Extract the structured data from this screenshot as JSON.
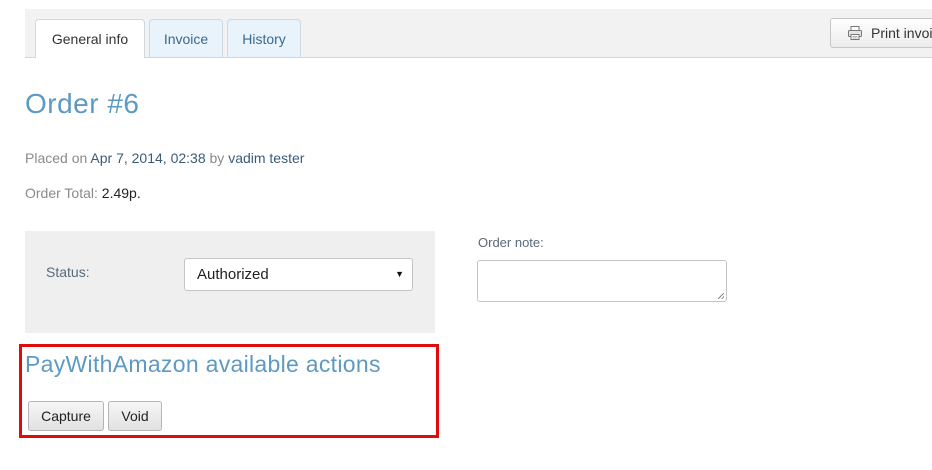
{
  "tabs": [
    {
      "label": "General info",
      "active": true
    },
    {
      "label": "Invoice",
      "active": false
    },
    {
      "label": "History",
      "active": false
    }
  ],
  "toolbar": {
    "print_label": "Print invoi",
    "print_icon": "printer-icon"
  },
  "order": {
    "title": "Order #6",
    "placed_prefix": "Placed on",
    "placed_date": "Apr 7, 2014, 02:38",
    "placed_by_word": "by",
    "placed_by_name": "vadim tester",
    "total_label": "Order Total:",
    "total_value": "2.49p."
  },
  "status": {
    "label": "Status:",
    "selected": "Authorized"
  },
  "note": {
    "label": "Order note:",
    "value": ""
  },
  "actions": {
    "title": "PayWithAmazon available actions",
    "capture_label": "Capture",
    "void_label": "Void"
  },
  "colors": {
    "heading": "#5d9ac3",
    "highlight_border": "#e00b0b",
    "tab_inactive_bg": "#e8f3fb"
  }
}
